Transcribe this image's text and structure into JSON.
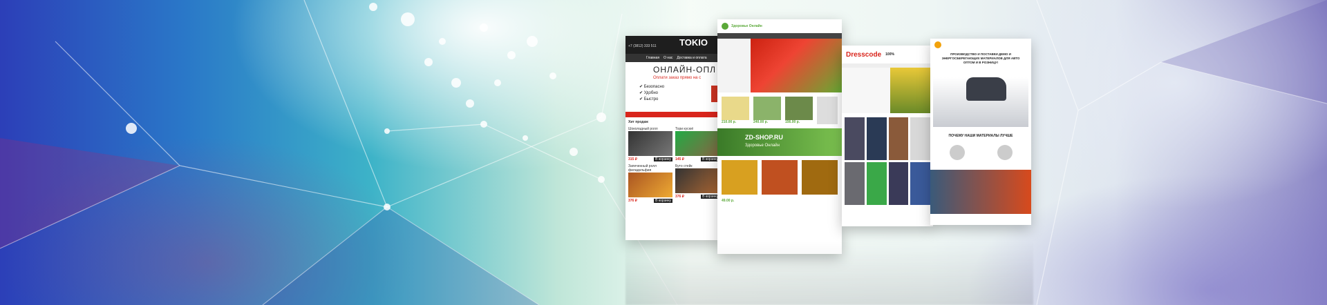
{
  "sites": {
    "tokio": {
      "logo": "TOKIO",
      "phone": "+7 (3812) 333 511",
      "nav": [
        "Главная",
        "О нас",
        "Доставка и оплата"
      ],
      "headline": "ОНЛАЙН-ОПЛ",
      "subline": "Оплати заказ прямо на с",
      "checks": [
        "Безопасно",
        "Удобно",
        "Быстро"
      ],
      "section": "Хит продаж",
      "products": [
        {
          "name": "Шоколадный ролл",
          "price": "315 ₽"
        },
        {
          "name": "Тори кусюё",
          "price": "145 ₽"
        },
        {
          "name": "Запеченный ролл филадельфия",
          "price": "376 ₽"
        },
        {
          "name": "Буто стейк",
          "price": "376 ₽"
        }
      ],
      "cart_label": "В корзину"
    },
    "zdorovye": {
      "brand": "Здоровье Онлайн",
      "prices": [
        "210.00 р.",
        "240.00 р.",
        "156.00 р.",
        "49.00 р."
      ],
      "banner": "ZD-SHOP.RU",
      "banner_sub": "Здоровье Онлайн"
    },
    "dresscode": {
      "logo": "Dresscode",
      "badge": "100%"
    },
    "oil": {
      "title": "ПРОИЗВОДСТВО И ПОСТАВКИ ДЕМО И ЭНЕРГОСБЕРЕГАЮЩИХ МАТЕРИАЛОВ ДЛЯ АВТО ОПТОМ И В РОЗНИЦУ!",
      "section": "ПОЧЕМУ НАШИ МАТЕРИАЛЫ ЛУЧШЕ"
    }
  },
  "colors": {
    "accent_red": "#d9251c",
    "accent_green": "#5aa838",
    "dark": "#222222"
  }
}
